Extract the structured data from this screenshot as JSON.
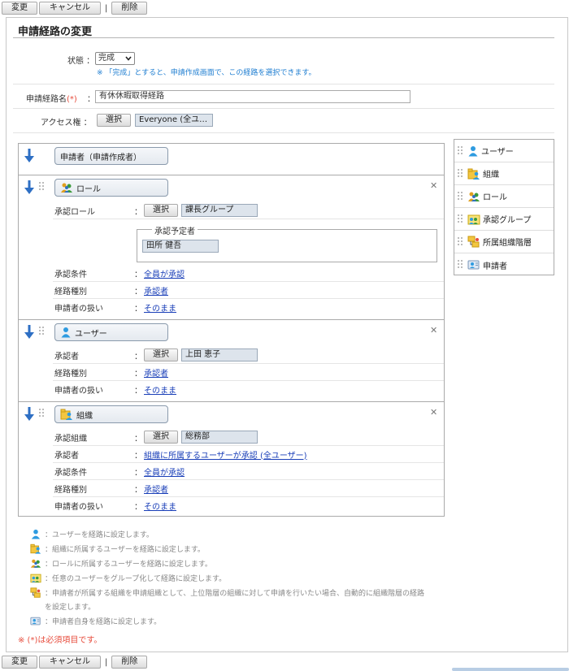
{
  "toolbar": {
    "change": "変更",
    "cancel": "キャンセル",
    "separator": "|",
    "delete": "削除"
  },
  "page_title": "申請経路の変更",
  "status": {
    "label": "状態 ：",
    "value": "完成",
    "hint": "※ 「完成」とすると、申請作成画面で、この経路を選択できます。"
  },
  "route_name": {
    "label": "申請経路名",
    "required_mark": "(*)",
    "colon": "：",
    "value": "有休休暇取得経路"
  },
  "access": {
    "label": "アクセス権 ：",
    "select_button": "選択",
    "value": "Everyone (全ユ…"
  },
  "applicant_node": {
    "label": "申請者（申請作成者）"
  },
  "blocks": [
    {
      "type": "role",
      "node_label": "ロール",
      "rows": [
        {
          "key": "承認ロール",
          "select_button": "選択",
          "value": "課長グループ"
        },
        {
          "key": "承認条件",
          "link": "全員が承認"
        },
        {
          "key": "経路種別",
          "link": "承認者"
        },
        {
          "key": "申請者の扱い",
          "link": "そのまま"
        }
      ],
      "planned": {
        "legend": "承認予定者",
        "value": "田所 健吾"
      }
    },
    {
      "type": "user",
      "node_label": "ユーザー",
      "rows": [
        {
          "key": "承認者",
          "select_button": "選択",
          "value": "上田 恵子"
        },
        {
          "key": "経路種別",
          "link": "承認者"
        },
        {
          "key": "申請者の扱い",
          "link": "そのまま"
        }
      ]
    },
    {
      "type": "org",
      "node_label": "組織",
      "rows": [
        {
          "key": "承認組織",
          "select_button": "選択",
          "value": "総務部"
        },
        {
          "key": "承認者",
          "link": "組織に所属するユーザーが承認 (全ユーザー)"
        },
        {
          "key": "承認条件",
          "link": "全員が承認"
        },
        {
          "key": "経路種別",
          "link": "承認者"
        },
        {
          "key": "申請者の扱い",
          "link": "そのまま"
        }
      ]
    }
  ],
  "colon": "：",
  "help": [
    {
      "icon": "user-icon",
      "text": "：ユーザーを経路に設定します。"
    },
    {
      "icon": "organization-icon",
      "text": "：組織に所属するユーザーを経路に設定します。"
    },
    {
      "icon": "role-icon",
      "text": "：ロールに所属するユーザーを経路に設定します。"
    },
    {
      "icon": "approval-group-icon",
      "text": "：任意のユーザーをグループ化して経路に設定します。"
    },
    {
      "icon": "affiliated-hierarchy-icon",
      "text": "：申請者が所属する組織を申請組織として、上位階層の組織に対して申請を行いたい場合、自動的に組織階層の経路を設定します。"
    },
    {
      "icon": "applicant-icon",
      "text": "：申請者自身を経路に設定します。"
    }
  ],
  "required_note": "※ (*)は必須項目です。",
  "palette": [
    {
      "icon": "user-icon",
      "label": "ユーザー"
    },
    {
      "icon": "organization-icon",
      "label": "組織"
    },
    {
      "icon": "role-icon",
      "label": "ロール"
    },
    {
      "icon": "approval-group-icon",
      "label": "承認グループ"
    },
    {
      "icon": "affiliated-hierarchy-icon",
      "label": "所属組織階層"
    },
    {
      "icon": "applicant-icon",
      "label": "申請者"
    }
  ],
  "colors": {
    "accent_blue": "#2e6fc4",
    "required_red": "#e74c3c",
    "hint_blue": "#1f7ed1",
    "link": "#1a3fb8"
  }
}
